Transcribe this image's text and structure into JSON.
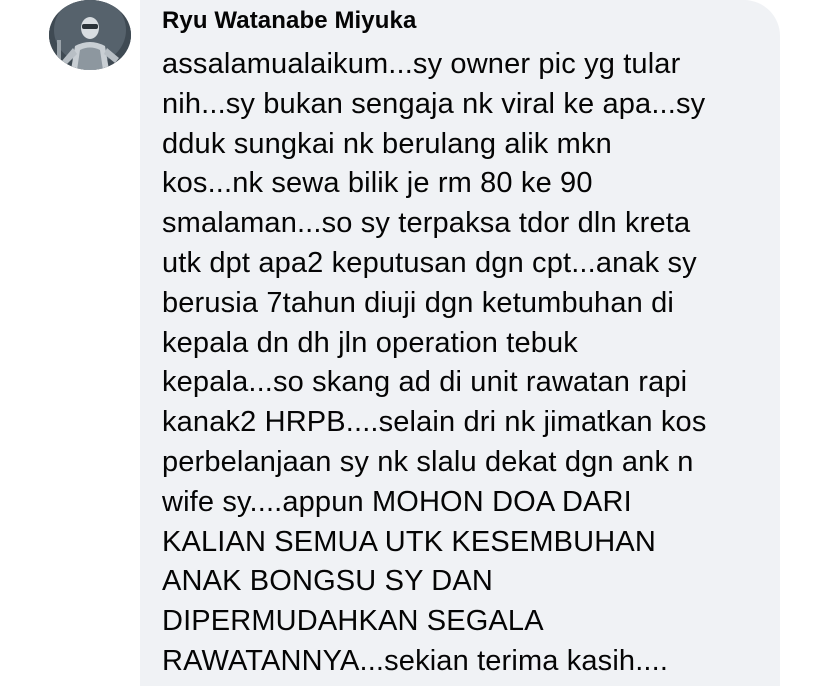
{
  "comment": {
    "author": "Ryu Watanabe Miyuka",
    "lines": [
      "assalamualaikum...sy owner pic yg tular",
      "nih...sy bukan sengaja nk viral ke apa...sy",
      "dduk sungkai nk berulang alik mkn",
      "kos...nk sewa bilik je rm 80 ke 90",
      "smalaman...so sy terpaksa tdor dln kreta",
      "utk dpt apa2 keputusan dgn cpt...anak sy",
      "berusia 7tahun diuji dgn ketumbuhan di",
      "kepala dn dh jln operation tebuk",
      "kepala...so skang ad di unit rawatan rapi",
      "kanak2 HRPB....selain dri nk jimatkan kos",
      "perbelanjaan sy nk slalu dekat dgn ank n",
      "wife sy....appun MOHON DOA DARI",
      "KALIAN SEMUA UTK KESEMBUHAN",
      "ANAK BONGSU SY DAN",
      "DIPERMUDAHKAN SEGALA",
      "RAWATANNYA...sekian terima kasih...."
    ]
  },
  "colors": {
    "bubble_background": "#f0f2f5",
    "text": "#050505"
  },
  "icons": {
    "avatar": "profile-photo-armored-figure"
  }
}
